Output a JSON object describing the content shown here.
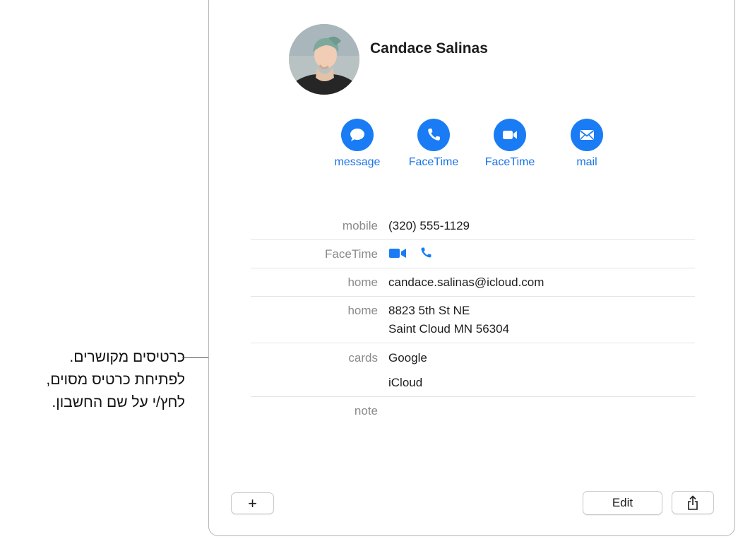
{
  "callout": {
    "lines": [
      "כרטיסים מקושרים.",
      "לפתיחת כרטיס מסוים,",
      "לחץ/י על שם החשבון."
    ]
  },
  "contact": {
    "name": "Candace Salinas",
    "avatar_alt": "Candace Salinas"
  },
  "actions": [
    {
      "label": "message",
      "icon": "message-bubble-icon"
    },
    {
      "label": "FaceTime",
      "icon": "phone-icon"
    },
    {
      "label": "FaceTime",
      "icon": "video-camera-icon"
    },
    {
      "label": "mail",
      "icon": "envelope-icon"
    }
  ],
  "fields": {
    "mobile": {
      "label": "mobile",
      "value": "(320) 555-1129"
    },
    "facetime": {
      "label": "FaceTime"
    },
    "email": {
      "label": "home",
      "value": "candace.salinas@icloud.com"
    },
    "address": {
      "label": "home",
      "line1": "8823 5th St NE",
      "line2": "Saint Cloud MN 56304"
    },
    "cards": {
      "label": "cards",
      "items": [
        "Google",
        "iCloud"
      ]
    },
    "note": {
      "label": "note"
    }
  },
  "toolbar": {
    "add_label": "+",
    "edit_label": "Edit"
  },
  "colors": {
    "accent": "#1a7cf5",
    "link_text": "#1a73e8",
    "label_gray": "#8a8a8a"
  }
}
